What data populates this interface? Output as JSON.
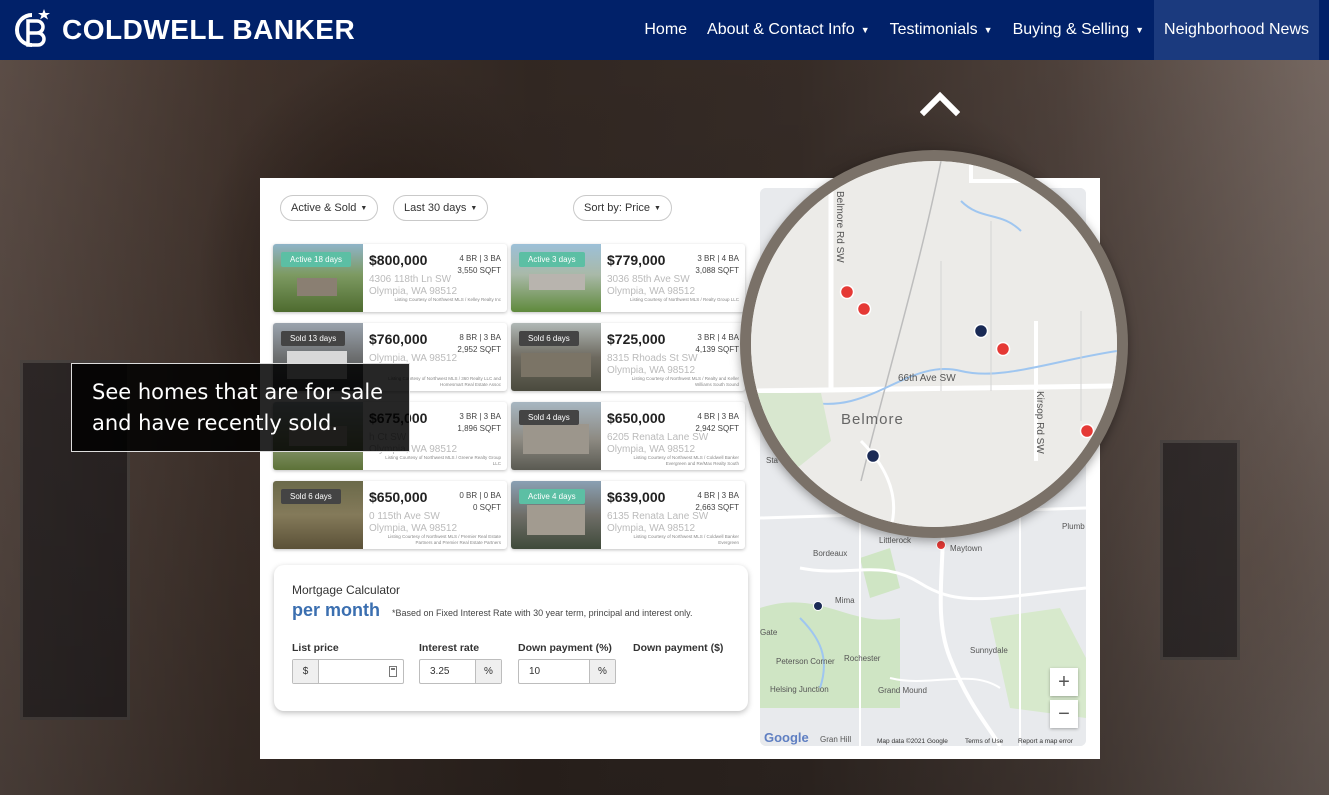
{
  "navbar": {
    "brand": "COLDWELL BANKER",
    "items": [
      {
        "label": "Home",
        "dropdown": false
      },
      {
        "label": "About & Contact Info",
        "dropdown": true
      },
      {
        "label": "Testimonials",
        "dropdown": true
      },
      {
        "label": "Buying & Selling",
        "dropdown": true
      },
      {
        "label": "Neighborhood News",
        "dropdown": false,
        "active": true
      }
    ]
  },
  "caption": "See homes that are for sale and have recently sold.",
  "filters": {
    "status": "Active & Sold",
    "period": "Last 30 days",
    "sort": "Sort by: Price"
  },
  "listings": [
    {
      "badge": "Active 18 days",
      "badge_type": "active",
      "price": "$800,000",
      "beds_baths": "4 BR | 3 BA",
      "sqft": "3,550 SQFT",
      "address": "4306 118th Ln SW",
      "city": "Olympia, WA 98512",
      "courtesy": "Listing Courtesy of Northwest MLS / Kelley Realty Inc"
    },
    {
      "badge": "Active 3 days",
      "badge_type": "active",
      "price": "$779,000",
      "beds_baths": "3 BR | 4 BA",
      "sqft": "3,088 SQFT",
      "address": "3036 85th Ave SW",
      "city": "Olympia, WA 98512",
      "courtesy": "Listing Courtesy of Northwest MLS / Realty Group LLC"
    },
    {
      "badge": "Sold 13 days",
      "badge_type": "sold",
      "price": "$760,000",
      "beds_baths": "8 BR | 3 BA",
      "sqft": "2,952 SQFT",
      "address": "",
      "city": "Olympia, WA 98512",
      "courtesy": "Listing Courtesy of Northwest MLS / 360 Realty LLC and Homesmart Real Estate Assoc"
    },
    {
      "badge": "Sold 6 days",
      "badge_type": "sold",
      "price": "$725,000",
      "beds_baths": "3 BR | 4 BA",
      "sqft": "4,139 SQFT",
      "address": "8315 Rhoads St SW",
      "city": "Olympia, WA 98512",
      "courtesy": "Listing Courtesy of Northwest MLS / Realty and Keller Williams South Sound"
    },
    {
      "badge": "",
      "badge_type": "sold",
      "price": "$675,000",
      "beds_baths": "3 BR | 3 BA",
      "sqft": "1,896 SQFT",
      "address": "h Ct SW",
      "city": "Olympia, WA 98512",
      "courtesy": "Listing Courtesy of Northwest MLS / Greene Realty Group LLC"
    },
    {
      "badge": "Sold 4 days",
      "badge_type": "sold",
      "price": "$650,000",
      "beds_baths": "4 BR | 3 BA",
      "sqft": "2,942 SQFT",
      "address": "6205 Renata Lane SW",
      "city": "Olympia, WA 98512",
      "courtesy": "Listing Courtesy of Northwest MLS / Coldwell Banker Evergreen and Re/Max Realty South"
    },
    {
      "badge": "Sold 6 days",
      "badge_type": "sold",
      "price": "$650,000",
      "beds_baths": "0 BR | 0 BA",
      "sqft": "0 SQFT",
      "address": "0 115th Ave SW",
      "city": "Olympia, WA 98512",
      "courtesy": "Listing Courtesy of Northwest MLS / Premier Real Estate Partners and Premier Real Estate Partners"
    },
    {
      "badge": "Active 4 days",
      "badge_type": "active",
      "price": "$639,000",
      "beds_baths": "4 BR | 3 BA",
      "sqft": "2,663 SQFT",
      "address": "6135 Renata Lane SW",
      "city": "Olympia, WA 98512",
      "courtesy": "Listing Courtesy of Northwest MLS / Coldwell Banker Evergreen"
    }
  ],
  "mortgage": {
    "title": "Mortgage Calculator",
    "per_month": "per month",
    "note": "*Based on Fixed Interest Rate with 30 year term, principal and interest only.",
    "list_price_label": "List price",
    "list_price_prefix": "$",
    "list_price_value": "",
    "interest_label": "Interest rate",
    "interest_value": "3.25",
    "interest_suffix": "%",
    "down_pct_label": "Down payment (%)",
    "down_pct_value": "10",
    "down_pct_suffix": "%",
    "down_amt_label": "Down payment ($)"
  },
  "map": {
    "places": [
      "Belmore",
      "Bordeaux",
      "Littlerock",
      "Maytown",
      "Mima",
      "Gate",
      "Sunnydale",
      "Rochester",
      "Grand Mound",
      "Helsing Junction",
      "Peterson Corner",
      "Plumb",
      "Sta",
      "Gran Hill"
    ],
    "roads": [
      "Belmore Rd SW",
      "66th Ave SW",
      "Kirsop Rd SW"
    ],
    "zoom_in": "+",
    "zoom_out": "−",
    "logo": "Google",
    "footer": [
      "Map data ©2021 Google",
      "Terms of Use",
      "Report a map error"
    ],
    "marker_colors": {
      "active": "#e53935",
      "sold": "#1a2a55"
    }
  },
  "colors": {
    "navbar": "#012169",
    "active_badge": "#5cbfa4",
    "per_month": "#3b6fb0"
  }
}
